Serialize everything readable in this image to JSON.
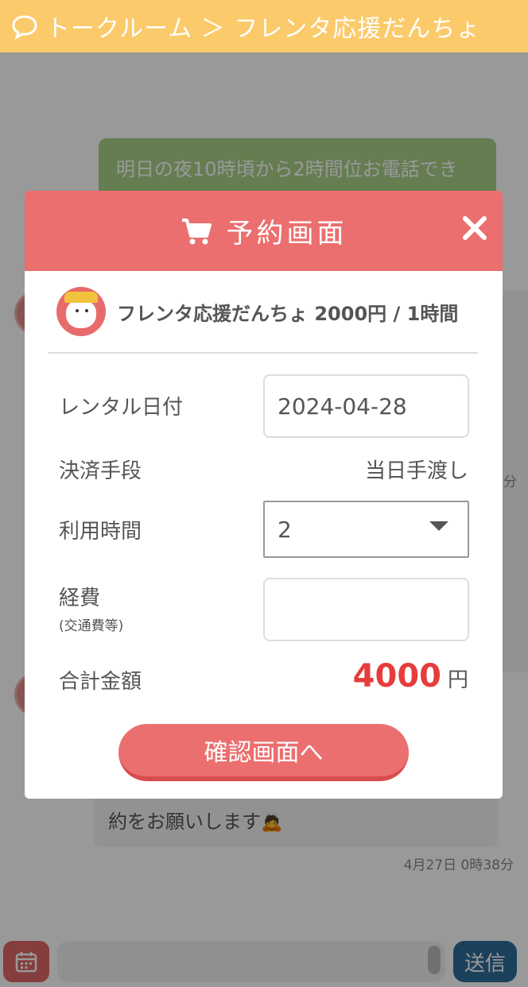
{
  "header": {
    "icon": "speech-bubble-icon",
    "title": "トークルーム ＞ フレンタ応援だんちょ"
  },
  "chat": {
    "messages": [
      {
        "side": "right",
        "text": "明日の夜10時頃から2時間位お電話でき"
      },
      {
        "side": "left",
        "text": "約をお願いします",
        "emoji": "🙇"
      }
    ],
    "timestamps": [
      "分",
      "4月27日 0時38分"
    ]
  },
  "modal": {
    "title": "予約画面",
    "cart_icon": "cart-icon",
    "close_icon": "close-icon",
    "rental_info": "フレンタ応援だんちょ 2000円 / 1時間",
    "date_label": "レンタル日付",
    "date_value": "2024-04-28",
    "payment_label": "決済手段",
    "payment_value": "当日手渡し",
    "time_label": "利用時間",
    "time_value": "2",
    "expense_label": "経費",
    "expense_sublabel": "(交通費等)",
    "expense_value": "",
    "total_label": "合計金額",
    "total_amount": "4000",
    "total_unit": "円",
    "confirm_button": "確認画面へ"
  },
  "bottom": {
    "calendar_icon": "calendar-icon",
    "message_placeholder": "",
    "send_button": "送信"
  },
  "colors": {
    "header": "#fbca6a",
    "modal_accent": "#eb6f6f",
    "total_amount": "#e63c3c",
    "send_button": "#2e6c99",
    "bubble_right": "#a7d088"
  }
}
